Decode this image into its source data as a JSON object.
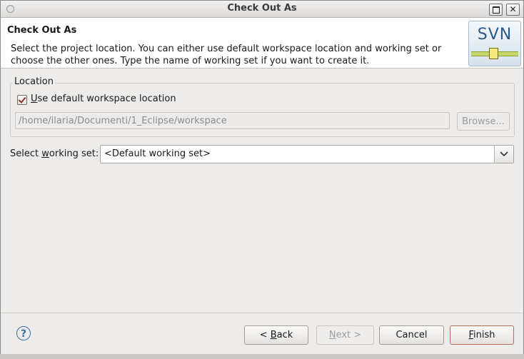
{
  "window": {
    "title": "Check Out As"
  },
  "header": {
    "title": "Check Out As",
    "description": "Select the project location. You can either use default workspace location and working set or choose the other ones. Type the name of working set if you want to create it.",
    "logo_text": "SVN"
  },
  "location": {
    "group_label": "Location",
    "use_default": {
      "label_mnemonic": "U",
      "label_rest": "se default workspace location",
      "checked": true
    },
    "path_value": "/home/ilaria/Documenti/1_Eclipse/workspace",
    "browse_label": "Browse..."
  },
  "working_set": {
    "label_prefix": "Select ",
    "label_mnemonic": "w",
    "label_rest": "orking set:",
    "value": "<Default working set>"
  },
  "footer": {
    "help_glyph": "?",
    "back_prefix": "< ",
    "back_mnemonic": "B",
    "back_rest": "ack",
    "next_mnemonic": "N",
    "next_rest": "ext >",
    "cancel_label": "Cancel",
    "finish_mnemonic": "F",
    "finish_rest": "inish"
  },
  "colors": {
    "window_bg": "#edeceb",
    "header_bg": "#ffffff",
    "focus_border": "#b86a5a"
  }
}
